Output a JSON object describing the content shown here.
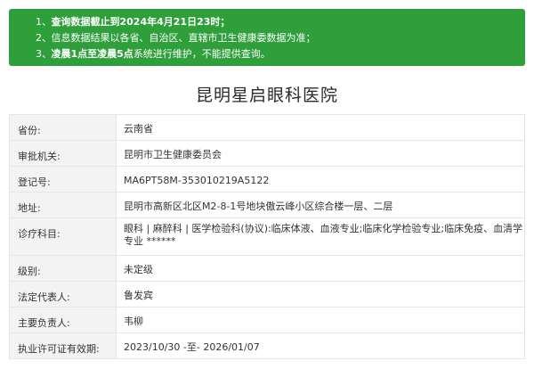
{
  "notice": {
    "items": [
      {
        "num": "1、",
        "text": "查询数据截止到2024年4月21日23时；"
      },
      {
        "num": "2、",
        "text": "信息数据结果以各省、自治区、直辖市卫生健康委数据为准；"
      },
      {
        "num": "3、",
        "bold": "凌晨1点至凌晨5点",
        "text": "系统进行维护，不能提供查询。"
      }
    ]
  },
  "hospital": {
    "name": "昆明星启眼科医院"
  },
  "info": [
    {
      "label": "省份:",
      "value": "云南省"
    },
    {
      "label": "审批机关:",
      "value": "昆明市卫生健康委员会"
    },
    {
      "label": "登记号:",
      "value": "MA6PT58M-353010219A5122"
    },
    {
      "label": "地址:",
      "value": "昆明市高新区北区M2-8-1号地块傲云峰小区综合楼一层、二层"
    },
    {
      "label": "诊疗科目:",
      "value": "眼科 | 麻醉科 | 医学检验科(协议):临床体液、血液专业;临床化学检验专业;临床免疫、血清学专业 ******"
    },
    {
      "label": "级别:",
      "value": "未定级"
    },
    {
      "label": "法定代表人:",
      "value": "鲁发宾"
    },
    {
      "label": "主要负责人:",
      "value": "韦柳"
    },
    {
      "label": "执业许可证有效期:",
      "value": "2023/10/30 -至- 2026/01/07"
    }
  ]
}
